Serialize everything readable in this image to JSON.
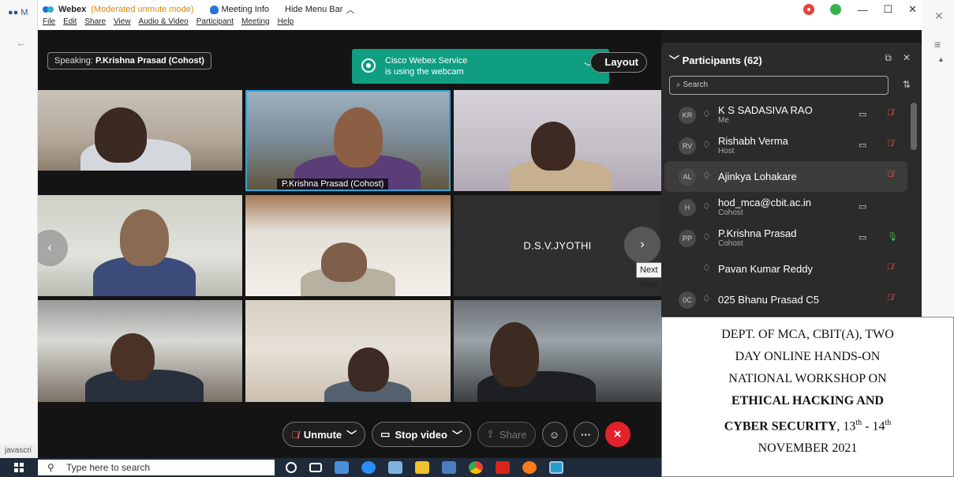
{
  "browser": {
    "tab_short": "M",
    "status_text": "javascri"
  },
  "titlebar": {
    "app_name": "Webex",
    "mode": "(Moderated unmute mode)",
    "meeting_info": "Meeting Info",
    "hide_menu": "Hide Menu Bar"
  },
  "menu": [
    "File",
    "Edit",
    "Share",
    "View",
    "Audio & Video",
    "Participant",
    "Meeting",
    "Help"
  ],
  "stage": {
    "speaking_prefix": "Speaking:",
    "speaking_name": "P.Krishna Prasad (Cohost)",
    "toast_line1": "Cisco Webex Service",
    "toast_line2": "is using the webcam",
    "layout_label": "Layout",
    "tile_label": "P.Krishna Prasad  (Cohost)",
    "no_video_name": "D.S.V.JYOTHI",
    "tooltip": "Next page"
  },
  "controls": {
    "unmute": "Unmute",
    "stop_video": "Stop video",
    "share": "Share"
  },
  "participants": {
    "header": "Participants (62)",
    "search_placeholder": "Search",
    "items": [
      {
        "initials": "KR",
        "name": "K S SADASIVA RAO",
        "role": "Me",
        "video": true,
        "mic": "muted"
      },
      {
        "initials": "RV",
        "name": "Rishabh Verma",
        "role": "Host",
        "video": true,
        "mic": "muted"
      },
      {
        "initials": "AL",
        "name": "Ajinkya Lohakare",
        "role": "",
        "video": false,
        "mic": "muted"
      },
      {
        "initials": "H",
        "name": "hod_mca@cbit.ac.in",
        "role": "Cohost",
        "video": true,
        "mic": "none"
      },
      {
        "initials": "PP",
        "name": "P.Krishna Prasad",
        "role": "Cohost",
        "video": true,
        "mic": "on"
      },
      {
        "initials": "",
        "name": "Pavan Kumar Reddy",
        "role": "",
        "video": false,
        "mic": "muted"
      },
      {
        "initials": "0C",
        "name": "025 Bhanu Prasad C5",
        "role": "",
        "video": false,
        "mic": "muted"
      }
    ]
  },
  "caption": {
    "line1": "DEPT. OF MCA, CBIT(A), TWO",
    "line2": "DAY ONLINE HANDS-ON",
    "line3": "NATIONAL WORKSHOP ON",
    "line4": "ETHICAL HACKING AND",
    "line5_bold": "CYBER SECURITY",
    "line5_rest": ", 13",
    "sup1": "th",
    "dash": "  - 14",
    "sup2": "th",
    "line6": "NOVEMBER 2021"
  },
  "taskbar": {
    "search_placeholder": "Type here to search"
  },
  "colors": {
    "webex_green": "#0f9e82",
    "mute_red": "#ff5050",
    "end_red": "#e2222c",
    "mode_orange": "#d98a00"
  }
}
